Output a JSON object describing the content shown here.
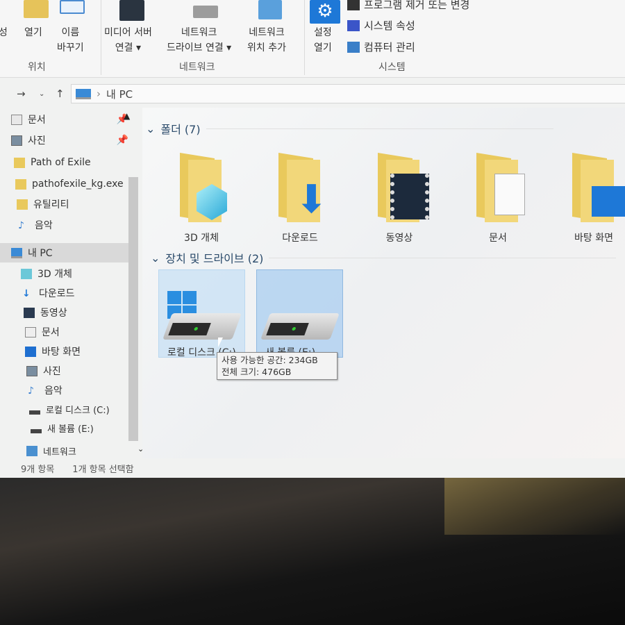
{
  "ribbon": {
    "left_cut": "성",
    "open": "열기",
    "rename": [
      "이름",
      "바꾸기"
    ],
    "media": [
      "미디어 서버",
      "연결 ▾"
    ],
    "map_drive": [
      "네트워크",
      "드라이브 연결 ▾"
    ],
    "add_location": [
      "네트워크",
      "위치 추가"
    ],
    "settings": [
      "설정",
      "열기"
    ],
    "uninstall": "프로그램 제거 또는 변경",
    "sys_props": "시스템 속성",
    "manage": "컴퓨터 관리",
    "groups": {
      "location": "위치",
      "network": "네트워크",
      "system": "시스템"
    }
  },
  "address": {
    "path": "내 PC"
  },
  "nav": {
    "quick": [
      {
        "label": "문서",
        "icon": "document-icon",
        "pinned": true
      },
      {
        "label": "사진",
        "icon": "pictures-icon",
        "pinned": true
      },
      {
        "label": "Path of Exile",
        "icon": "folder-icon"
      },
      {
        "label": "pathofexile_kg.exe",
        "icon": "folder-icon"
      },
      {
        "label": "유틸리티",
        "icon": "folder-icon"
      },
      {
        "label": "음악",
        "icon": "music-icon"
      }
    ],
    "this_pc": "내 PC",
    "pc_items": [
      {
        "label": "3D 개체",
        "icon": "cube-icon"
      },
      {
        "label": "다운로드",
        "icon": "download-icon"
      },
      {
        "label": "동영상",
        "icon": "video-icon"
      },
      {
        "label": "문서",
        "icon": "document-icon"
      },
      {
        "label": "바탕 화면",
        "icon": "desktop-icon"
      },
      {
        "label": "사진",
        "icon": "pictures-icon"
      },
      {
        "label": "음악",
        "icon": "music-icon"
      },
      {
        "label": "로컬 디스크 (C:)",
        "icon": "drive-icon"
      },
      {
        "label": "새 볼륨 (E:)",
        "icon": "drive-icon"
      }
    ],
    "network": "네트워크"
  },
  "main": {
    "folders_header": "폴더 (7)",
    "folders": [
      {
        "label": "3D 개체",
        "icon": "cube-icon"
      },
      {
        "label": "다운로드",
        "icon": "download-icon"
      },
      {
        "label": "동영상",
        "icon": "video-icon"
      },
      {
        "label": "문서",
        "icon": "document-icon"
      },
      {
        "label": "바탕 화면",
        "icon": "desktop-icon"
      }
    ],
    "drives_header": "장치 및 드라이브 (2)",
    "drives": [
      {
        "label": "로컬 디스크 (C:)"
      },
      {
        "label": "새 볼륨 (E:)"
      }
    ],
    "tooltip": {
      "free": "사용 가능한 공간: 234GB",
      "total": "전체 크기: 476GB"
    }
  },
  "status": {
    "items": "9개 항목",
    "selected": "1개 항목 선택함"
  },
  "colors": {
    "accent": "#1e78d7",
    "folder": "#e9c95c",
    "selection": "#cce4f7"
  }
}
